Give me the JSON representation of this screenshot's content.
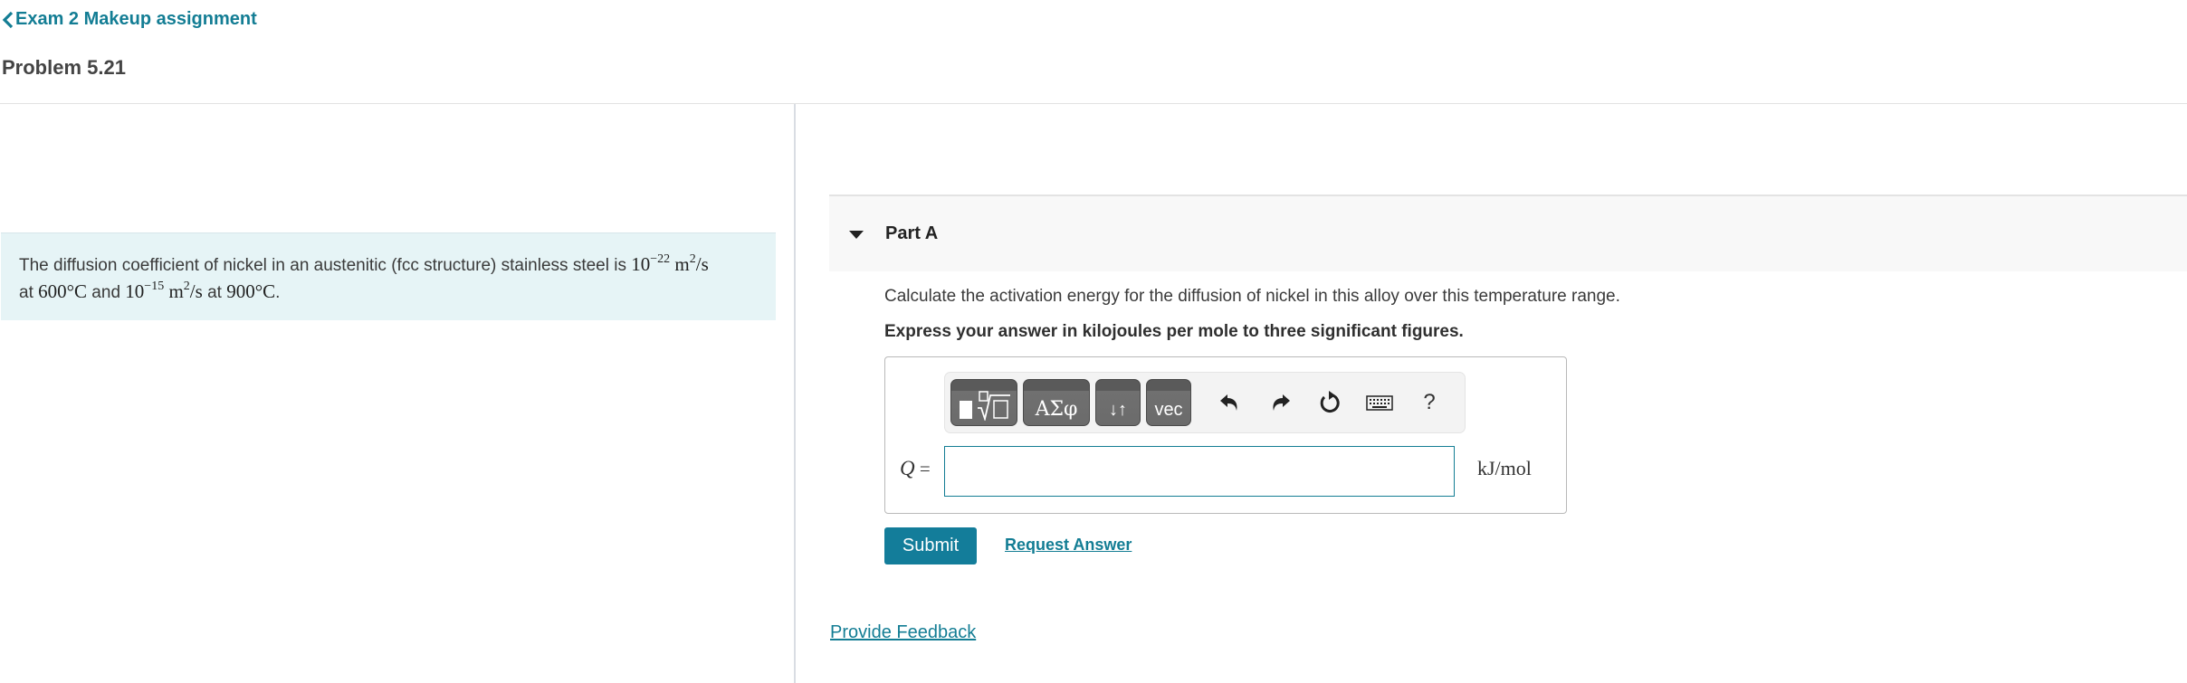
{
  "nav": {
    "back_label": "Exam 2 Makeup assignment",
    "problem_title": "Problem 5.21"
  },
  "intro": {
    "text_1": "The diffusion coefficient of nickel in an austenitic (fcc structure) stainless steel is ",
    "d1_base": "10",
    "d1_exp": "−22",
    "unit_m": " m",
    "unit_sq": "2",
    "unit_per_s": "/s",
    "text_2": "at ",
    "t1": "600°C",
    "text_3": " and ",
    "d2_base": "10",
    "d2_exp": "−15",
    "text_4": " at ",
    "t2": "900°C",
    "text_5": "."
  },
  "part": {
    "title": "Part A",
    "question": "Calculate the activation energy for the diffusion of nickel in this alloy over this temperature range.",
    "instruction": "Express your answer in kilojoules per mole to three significant figures."
  },
  "toolbar": {
    "templates_icon": "templates-icon",
    "greek_label": "ΑΣφ",
    "arrows_label": "↓↑",
    "vec_label": "vec",
    "help_label": "?"
  },
  "answer": {
    "variable": "Q",
    "equals": " =",
    "value": "",
    "placeholder": "",
    "units": "kJ/mol"
  },
  "actions": {
    "submit_label": "Submit",
    "request_answer_label": "Request Answer",
    "feedback_label": "Provide Feedback"
  },
  "colors": {
    "accent": "#137d94",
    "intro_bg": "#e6f4f6",
    "part_header_bg": "#f8f8f8"
  }
}
